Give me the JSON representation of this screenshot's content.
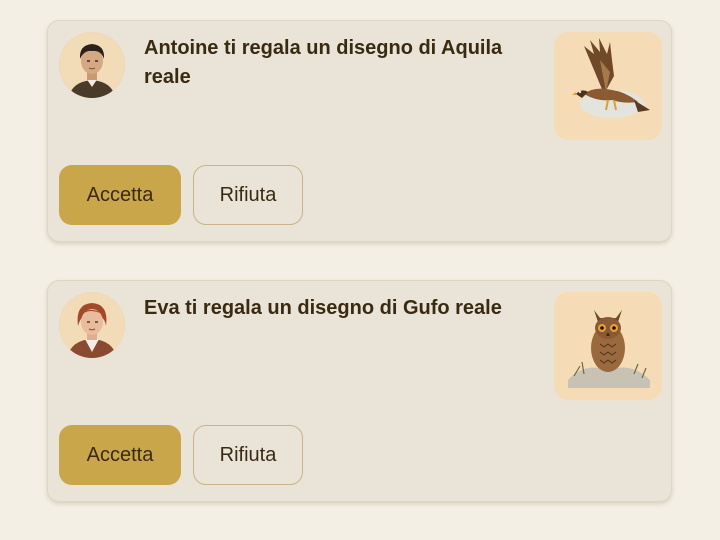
{
  "notifications": [
    {
      "sender": "Antoine",
      "message": "Antoine ti regala un disegno di Aquila reale",
      "avatar_icon": "man-portrait",
      "drawing_icon": "golden-eagle-drawing",
      "accept_label": "Accetta",
      "reject_label": "Rifiuta"
    },
    {
      "sender": "Eva",
      "message": "Eva ti regala un disegno di Gufo reale",
      "avatar_icon": "woman-portrait",
      "drawing_icon": "eagle-owl-drawing",
      "accept_label": "Accetta",
      "reject_label": "Rifiuta"
    }
  ],
  "colors": {
    "background": "#f3efe4",
    "card": "#e9e4d7",
    "accent": "#c9a64a",
    "text": "#3a2a12"
  }
}
